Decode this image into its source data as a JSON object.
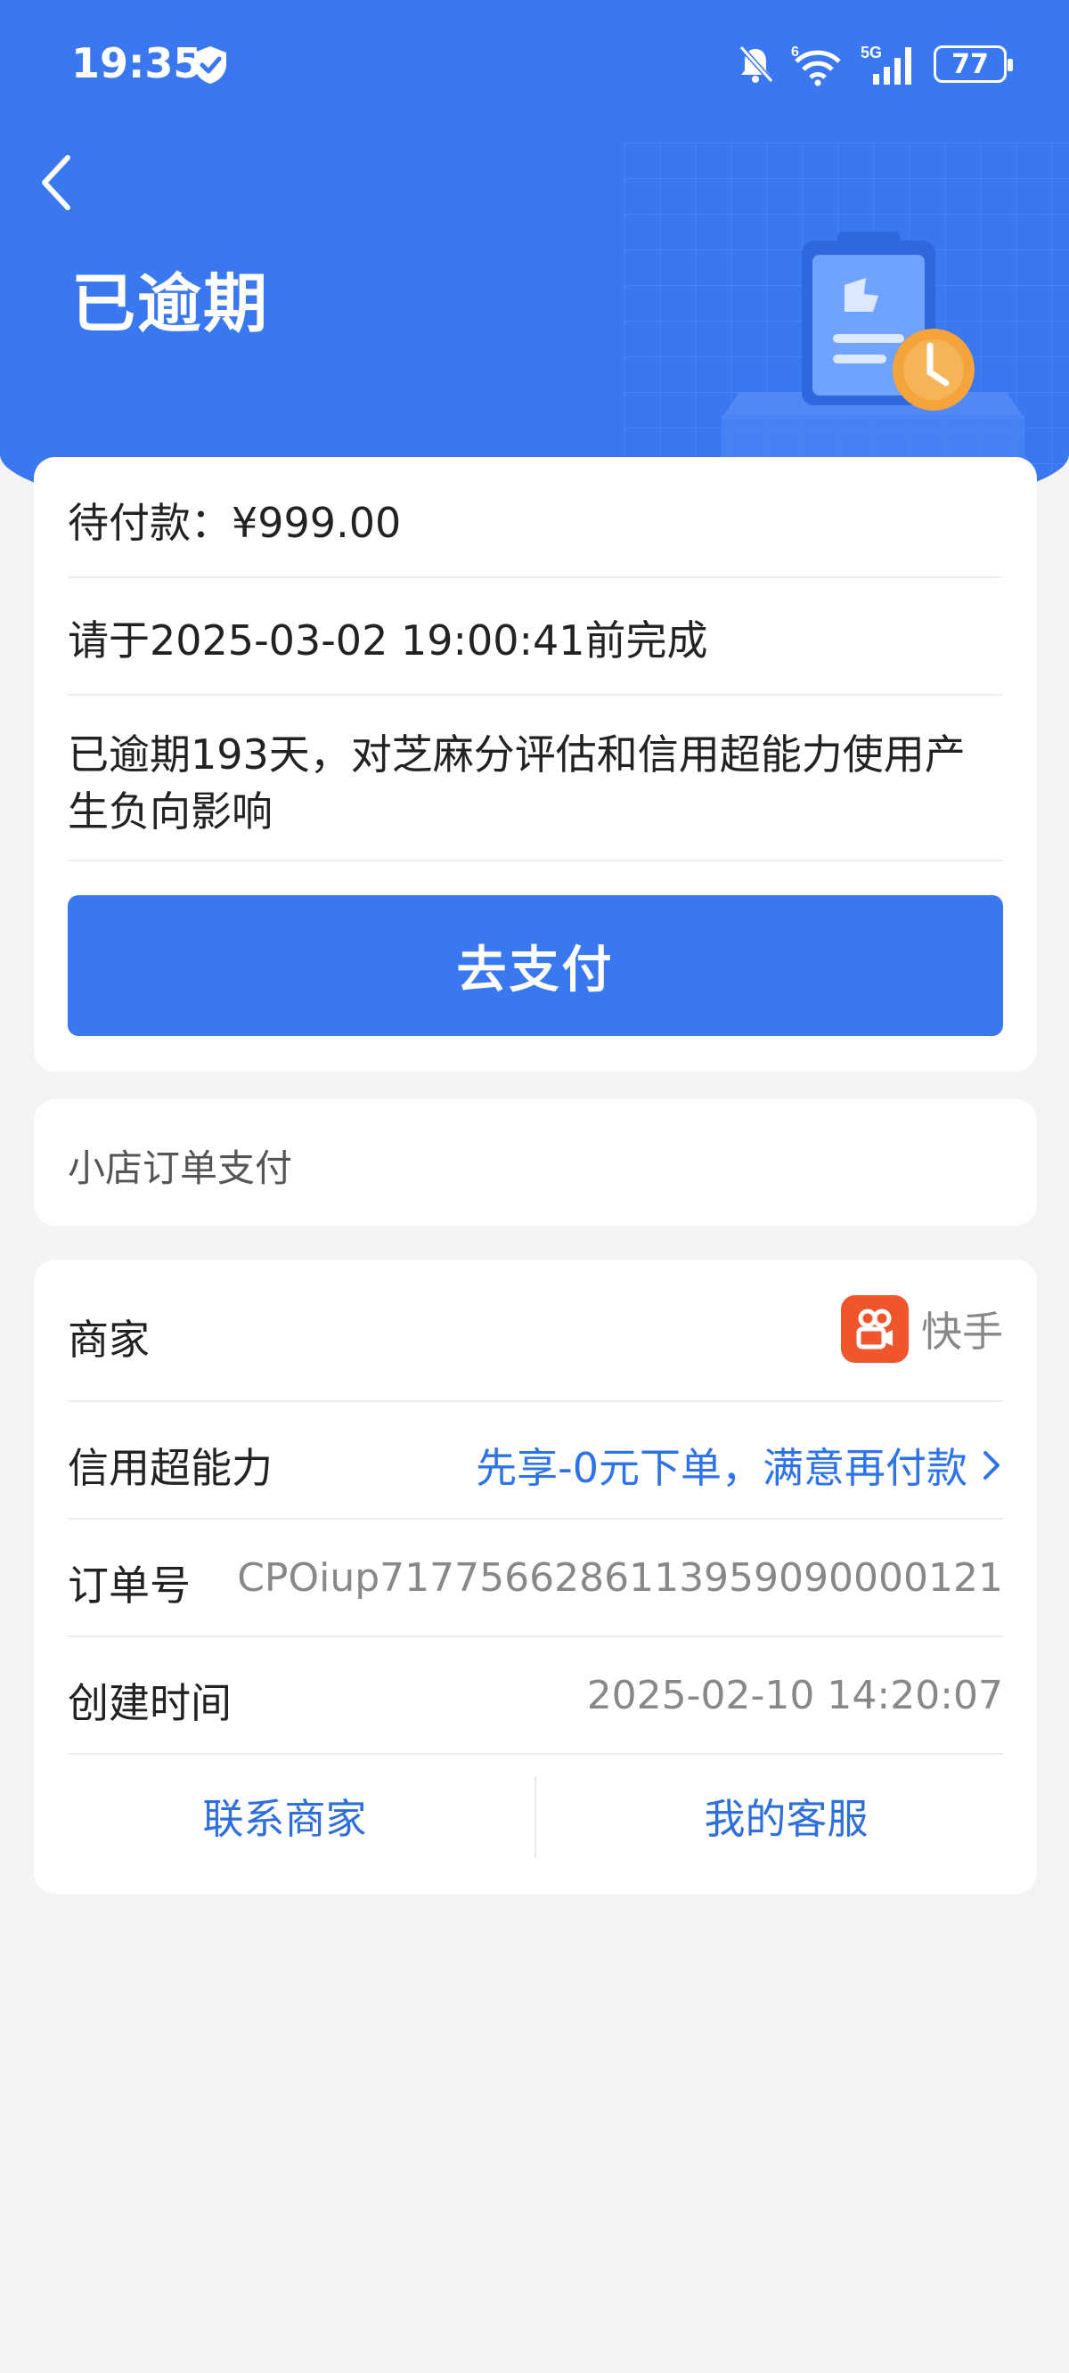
{
  "status_bar": {
    "time": "19:35",
    "battery": "77",
    "network": "5G",
    "wifi_badge": "6"
  },
  "header": {
    "title": "已逾期"
  },
  "payment_card": {
    "amount_label": "待付款：¥999.00",
    "deadline": "请于2025-03-02 19:00:41前完成",
    "overdue_line1": "已逾期193天，对芝麻分评估和信用超能力使用产",
    "overdue_line2": "生负向影响",
    "pay_button": "去支付"
  },
  "order_type": {
    "label": "小店订单支付"
  },
  "details": {
    "merchant_label": "商家",
    "merchant_value": "快手",
    "credit_label": "信用超能力",
    "credit_value": "先享-0元下单，满意再付款",
    "order_no_label": "订单号",
    "order_no_value": "CPOiup717756628611395909000012​1",
    "created_label": "创建时间",
    "created_value": "2025-02-10 14:20:07",
    "contact_merchant": "联系商家",
    "my_service": "我的客服"
  },
  "colors": {
    "brand_blue": "#3a78f2",
    "link_blue": "#2f73ea",
    "kuaishou_orange": "#f0562d",
    "background": "#f4f4f4"
  },
  "icons": [
    "back-icon",
    "shield-icon",
    "mute-bell-icon",
    "wifi-icon",
    "signal-icon",
    "battery-icon",
    "clipboard-clock-illustration",
    "kuaishou-logo-icon",
    "chevron-right-icon"
  ]
}
